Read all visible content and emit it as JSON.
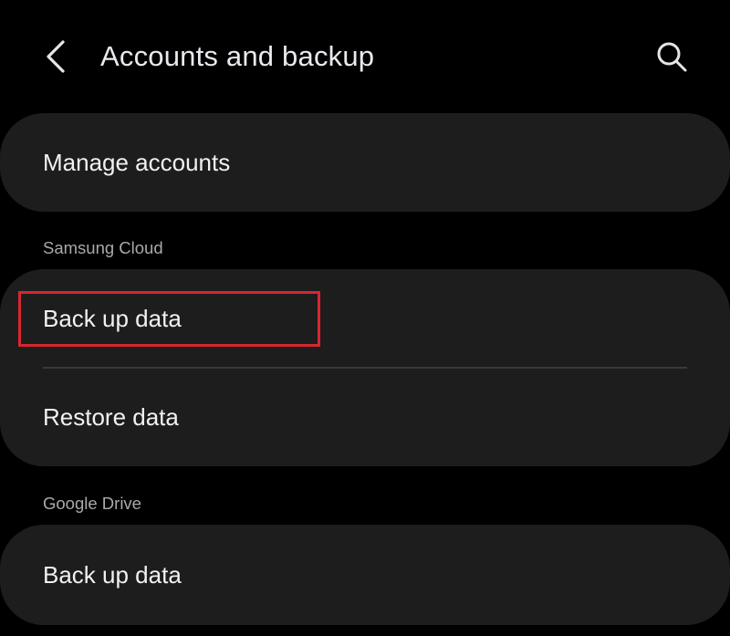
{
  "header": {
    "title": "Accounts and backup",
    "back_icon": "chevron-left-icon",
    "search_icon": "search-icon"
  },
  "accounts_card": {
    "manage_accounts_label": "Manage accounts"
  },
  "samsung_cloud": {
    "section_label": "Samsung Cloud",
    "back_up_label": "Back up data",
    "restore_label": "Restore data"
  },
  "google_drive": {
    "section_label": "Google Drive",
    "back_up_label": "Back up data"
  },
  "colors": {
    "background": "#000000",
    "card": "#1d1d1d",
    "highlight": "#d8262f",
    "section_label": "#a9a9a9"
  }
}
